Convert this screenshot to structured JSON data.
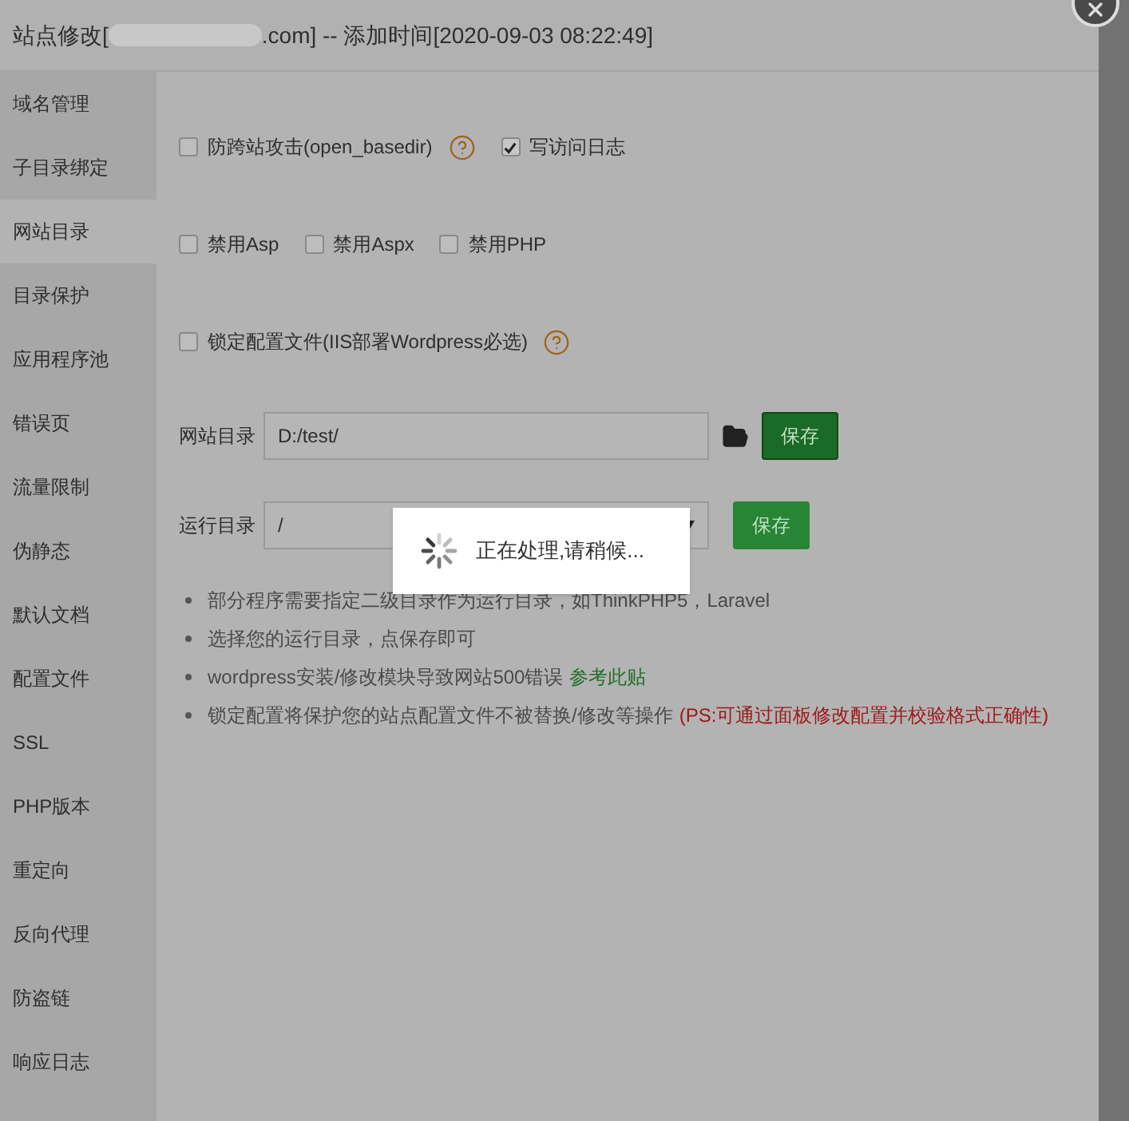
{
  "dialog": {
    "title_prefix": "站点修改[",
    "title_suffix": ".com] -- 添加时间[2020-09-03 08:22:49]"
  },
  "sidebar": {
    "items": [
      {
        "label": "域名管理",
        "selected": false
      },
      {
        "label": "子目录绑定",
        "selected": false
      },
      {
        "label": "网站目录",
        "selected": true
      },
      {
        "label": "目录保护",
        "selected": false
      },
      {
        "label": "应用程序池",
        "selected": false
      },
      {
        "label": "错误页",
        "selected": false
      },
      {
        "label": "流量限制",
        "selected": false
      },
      {
        "label": "伪静态",
        "selected": false
      },
      {
        "label": "默认文档",
        "selected": false
      },
      {
        "label": "配置文件",
        "selected": false
      },
      {
        "label": "SSL",
        "selected": false
      },
      {
        "label": "PHP版本",
        "selected": false
      },
      {
        "label": "重定向",
        "selected": false
      },
      {
        "label": "反向代理",
        "selected": false
      },
      {
        "label": "防盗链",
        "selected": false
      },
      {
        "label": "响应日志",
        "selected": false
      }
    ]
  },
  "option_rows": [
    [
      {
        "label": "防跨站攻击(open_basedir)",
        "checked": false,
        "help": true
      },
      {
        "label": "写访问日志",
        "checked": true,
        "help": false
      }
    ],
    [
      {
        "label": "禁用Asp",
        "checked": false,
        "help": false
      },
      {
        "label": "禁用Aspx",
        "checked": false,
        "help": false
      },
      {
        "label": "禁用PHP",
        "checked": false,
        "help": false
      }
    ],
    [
      {
        "label": "锁定配置文件(IIS部署Wordpress必选)",
        "checked": false,
        "help": true
      }
    ]
  ],
  "fields": [
    {
      "kind": "text",
      "label": "网站目录",
      "value": "D:/test/",
      "button": "保存"
    },
    {
      "kind": "select",
      "label": "运行目录",
      "value": "/",
      "button": "保存"
    }
  ],
  "tips": [
    {
      "text": "部分程序需要指定二级目录作为运行目录，如ThinkPHP5，Laravel"
    },
    {
      "text": "选择您的运行目录，点保存即可"
    },
    {
      "text": "wordpress安装/修改模块导致网站500错误",
      "link": "参考此贴"
    },
    {
      "text": "锁定配置将保护您的站点配置文件不被替换/修改等操作",
      "note": "(PS:可通过面板修改配置并校验格式正确性)"
    }
  ],
  "loading": {
    "text": "正在处理,请稍候..."
  }
}
